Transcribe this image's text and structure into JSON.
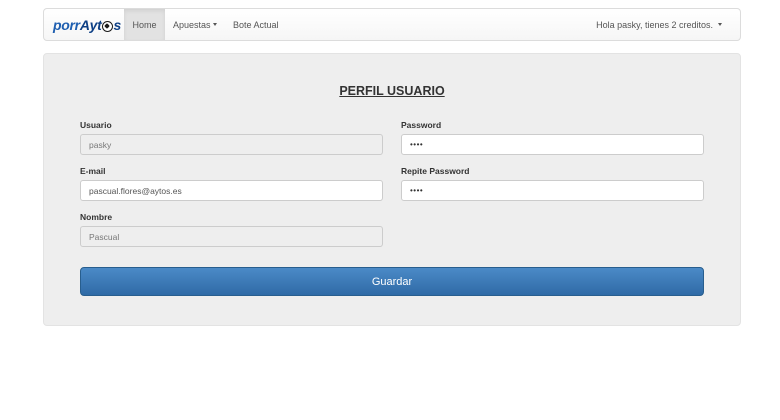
{
  "navbar": {
    "brand_part1": "porr",
    "brand_part2": "Ayt",
    "brand_part3": "s",
    "items": [
      {
        "label": "Home"
      },
      {
        "label": "Apuestas"
      },
      {
        "label": "Bote Actual"
      }
    ],
    "user_menu": "Hola pasky, tienes 2 creditos."
  },
  "form": {
    "title": "PERFIL USUARIO",
    "usuario": {
      "label": "Usuario",
      "value": "pasky"
    },
    "email": {
      "label": "E-mail",
      "value": "pascual.flores@aytos.es"
    },
    "nombre": {
      "label": "Nombre",
      "value": "Pascual"
    },
    "password": {
      "label": "Password",
      "value": "••••"
    },
    "repite_password": {
      "label": "Repite Password",
      "value": "••••"
    },
    "save_label": "Guardar"
  },
  "colors": {
    "brand": "#1f5fb0",
    "primary_button": "#337ab7",
    "panel_bg": "#eeeeee"
  }
}
